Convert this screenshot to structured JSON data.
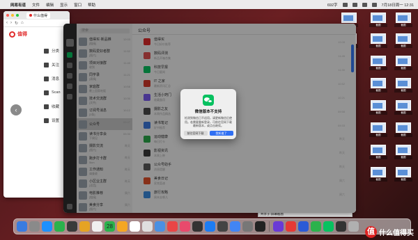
{
  "menubar": {
    "app_name": "网易有道",
    "menus": [
      "文件",
      "编辑",
      "显示",
      "窗口",
      "帮助"
    ],
    "status": "692字",
    "datetime": "7月18日周一 12:31"
  },
  "browser": {
    "tab_title": "什么值得",
    "logo_text": "值得",
    "nav_items": [
      "分类",
      "关注",
      "消息",
      "Scan",
      "收藏",
      "设置"
    ]
  },
  "wechat": {
    "search_placeholder": "搜索",
    "chat_list": [
      {
        "name": "值得买·新品推",
        "preview": "[链接]",
        "time": "12:03"
      },
      {
        "name": "数码爱好者群",
        "preview": "[图片]",
        "time": "11:52"
      },
      {
        "name": "项目对接群",
        "preview": "收到",
        "time": "11:40"
      },
      {
        "name": "同学录",
        "preview": "[表情]",
        "time": "11:21"
      },
      {
        "name": "家庭群",
        "preview": "晚上回家吃饭",
        "time": "10:58"
      },
      {
        "name": "技术交流群",
        "preview": "[文件]",
        "time": "10:30"
      },
      {
        "name": "订阅号消息",
        "preview": "[3条]",
        "time": "10:12"
      },
      {
        "name": "公众号",
        "preview": "",
        "time": "09:47"
      },
      {
        "name": "读书分享会",
        "preview": "下周见",
        "time": "09:30"
      },
      {
        "name": "摄影交流",
        "preview": "[图片]",
        "time": "昨天"
      },
      {
        "name": "跑步打卡群",
        "preview": "5km",
        "time": "昨天"
      },
      {
        "name": "工作通知",
        "preview": "请查收",
        "time": "昨天"
      },
      {
        "name": "小区业主群",
        "preview": "[语音]",
        "time": "昨天"
      },
      {
        "name": "电影推荐",
        "preview": "[链接]",
        "time": "周六"
      },
      {
        "name": "美食分享",
        "preview": "[图片]",
        "time": "周六"
      },
      {
        "name": "旅行计划",
        "preview": "出发",
        "time": "周五"
      }
    ],
    "main_title": "公众号",
    "accounts": [
      {
        "name": "值得买",
        "desc": "今日好价推荐",
        "time": "12:05",
        "color": "#e02a2a"
      },
      {
        "name": "数码评测",
        "desc": "新品开箱合集",
        "time": "11:46",
        "color": "#e05050"
      },
      {
        "name": "科技早报",
        "desc": "今日要闻",
        "time": "11:30",
        "color": "#07c160"
      },
      {
        "name": "IT 之家",
        "desc": "最新资讯汇总",
        "time": "10:52",
        "color": "#d63a2a"
      },
      {
        "name": "生活小窍门",
        "desc": "收藏备用",
        "time": "10:21",
        "color": "#7a5af0"
      },
      {
        "name": "摄影之友",
        "desc": "本周作品精选",
        "time": "09:58",
        "color": "#4a4a4a"
      },
      {
        "name": "读书笔记",
        "desc": "好书推荐",
        "time": "09:33",
        "color": "#3d7be0"
      },
      {
        "name": "运动健康",
        "desc": "每日打卡",
        "time": "昨天",
        "color": "#2aa84a"
      },
      {
        "name": "影视资讯",
        "desc": "本周上映",
        "time": "昨天",
        "color": "#3a3a3a"
      },
      {
        "name": "公众号助手",
        "desc": "消息提醒",
        "time": "昨天",
        "color": "#5a5a5a"
      },
      {
        "name": "美食日记",
        "desc": "家常菜谱",
        "time": "周六",
        "color": "#e2502a"
      },
      {
        "name": "旅行攻略",
        "desc": "周末去哪儿",
        "time": "周六",
        "color": "#3a8ae0"
      }
    ]
  },
  "modal": {
    "title": "微信版本不支持",
    "description": "检测到微信已不适用，请更新微信后使用。若需要重新登录，可前往官网下载最新版本，或点击继续。",
    "secondary_button": "前往官网下载",
    "primary_button": "我知道了"
  },
  "desktop": {
    "icon_labels": [
      "截图",
      "截图",
      "截图",
      "截图",
      "截图",
      "截图",
      "截图",
      "截图",
      "截图",
      "截图",
      "截图",
      "截图",
      "截图",
      "截图",
      "截图",
      "截图",
      "截图",
      "截图"
    ],
    "bg_text_lines": [
      "屏幕共享·屏幕截图",
      "共享于·屏幕截图"
    ]
  },
  "dock": {
    "calendar_day": "28",
    "app_colors": [
      "#3a7be0",
      "#8a8a8a",
      "#1e90ff",
      "#2bb24c",
      "#3a3a3a",
      "#e5a323",
      "#f0f0f0",
      "#2bb24c",
      "#f5a623",
      "#ffffff",
      "#dfdfdf",
      "#4a90e2",
      "#e94545",
      "#e84a6c",
      "#333333",
      "#1d7cf2",
      "#444444",
      "#4285f4",
      "#777777",
      "#222222",
      "#6a3ad6",
      "#e53935",
      "#2b5ad6",
      "#2bb24c",
      "#07c160",
      "#333333",
      "#b0b0b0"
    ]
  },
  "watermark": {
    "mark": "值",
    "text": "什么值得买"
  }
}
